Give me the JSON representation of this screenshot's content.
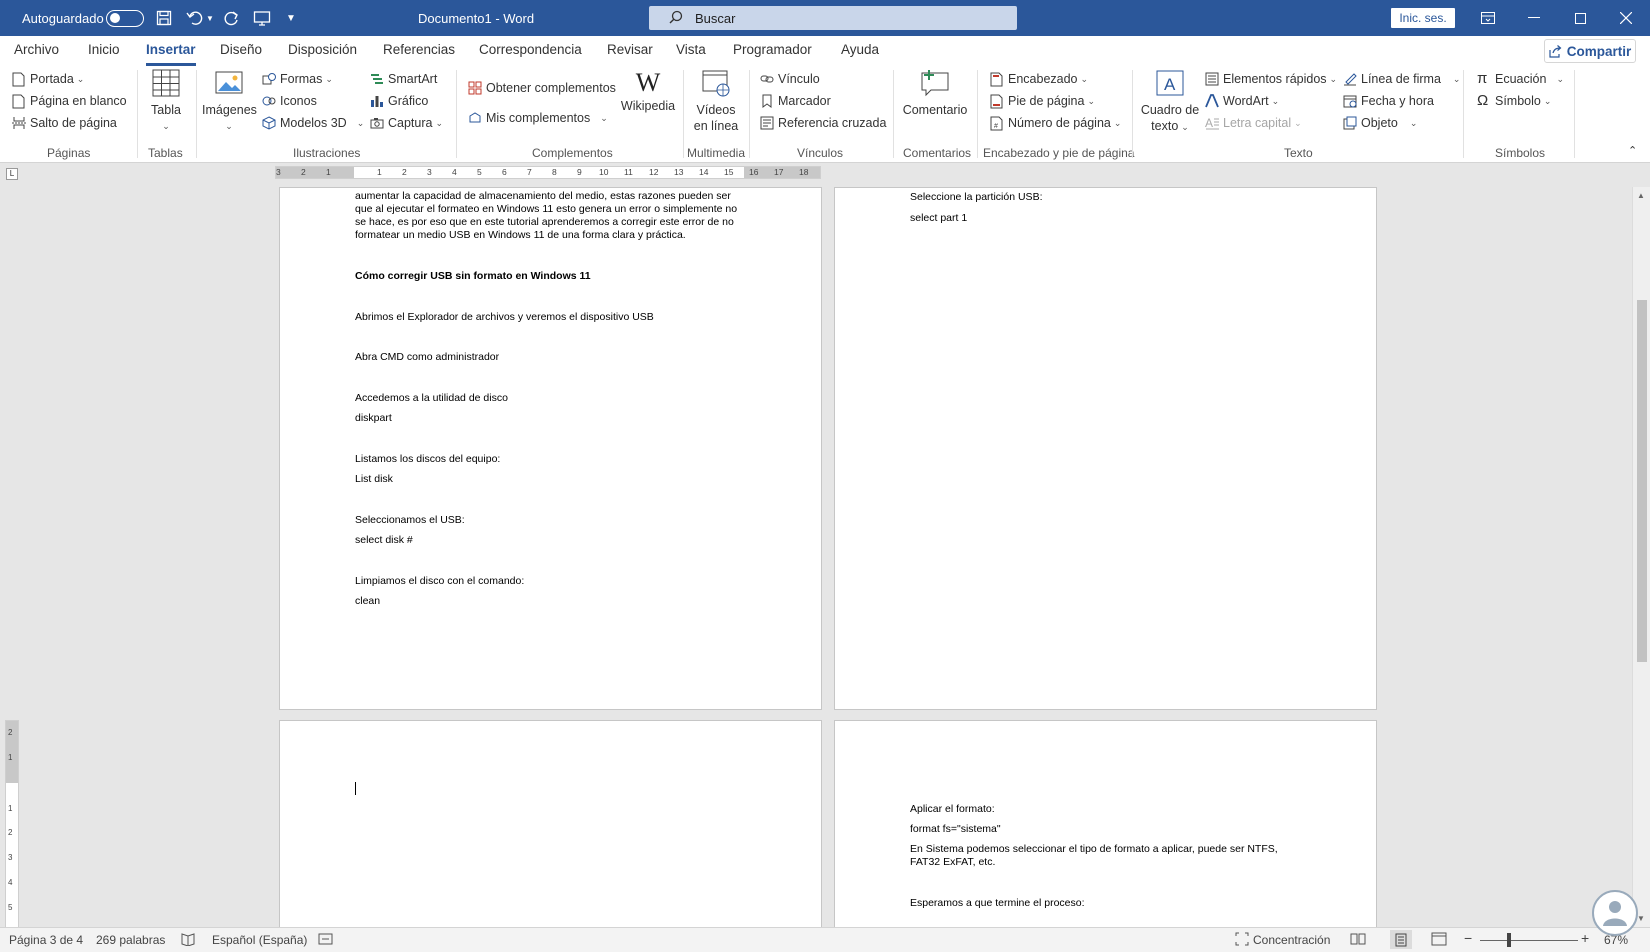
{
  "titlebar": {
    "autosave_label": "Autoguardado",
    "doc_title": "Documento1 - Word",
    "search_placeholder": "Buscar",
    "signin_label": "Inic. ses."
  },
  "tabs": [
    {
      "label": "Archivo"
    },
    {
      "label": "Inicio"
    },
    {
      "label": "Insertar"
    },
    {
      "label": "Diseño"
    },
    {
      "label": "Disposición"
    },
    {
      "label": "Referencias"
    },
    {
      "label": "Correspondencia"
    },
    {
      "label": "Revisar"
    },
    {
      "label": "Vista"
    },
    {
      "label": "Programador"
    },
    {
      "label": "Ayuda"
    }
  ],
  "share_label": "Compartir",
  "ribbon": {
    "paginas": {
      "portada": "Portada",
      "pagina_blanco": "Página en blanco",
      "salto": "Salto de página",
      "label": "Páginas"
    },
    "tablas": {
      "tabla": "Tabla",
      "label": "Tablas"
    },
    "ilustraciones": {
      "imagenes": "Imágenes",
      "formas": "Formas",
      "iconos": "Iconos",
      "modelos3d": "Modelos 3D",
      "smartart": "SmartArt",
      "grafico": "Gráfico",
      "captura": "Captura",
      "label": "Ilustraciones"
    },
    "complementos": {
      "obtener": "Obtener complementos",
      "mis": "Mis complementos",
      "wikipedia": "Wikipedia",
      "label": "Complementos"
    },
    "multimedia": {
      "videos_line1": "Vídeos",
      "videos_line2": "en línea",
      "label": "Multimedia"
    },
    "vinculos": {
      "vinculo": "Vínculo",
      "marcador": "Marcador",
      "referencia": "Referencia cruzada",
      "label": "Vínculos"
    },
    "comentarios": {
      "comentario": "Comentario",
      "label": "Comentarios"
    },
    "encabezado": {
      "encabezado": "Encabezado",
      "pie": "Pie de página",
      "numero": "Número de página",
      "label": "Encabezado y pie de página"
    },
    "texto": {
      "cuadro_line1": "Cuadro de",
      "cuadro_line2": "texto",
      "elementos": "Elementos rápidos",
      "wordart": "WordArt",
      "letra": "Letra capital",
      "linea_firma": "Línea de firma",
      "fecha": "Fecha y hora",
      "objeto": "Objeto",
      "label": "Texto"
    },
    "simbolos": {
      "ecuacion": "Ecuación",
      "simbolo": "Símbolo",
      "label": "Símbolos"
    }
  },
  "ruler_ticks": [
    "3",
    "2",
    "1",
    "1",
    "2",
    "3",
    "4",
    "5",
    "6",
    "7",
    "8",
    "9",
    "10",
    "11",
    "12",
    "13",
    "14",
    "15",
    "16",
    "17",
    "18"
  ],
  "vruler_ticks": [
    "2",
    "1",
    "1",
    "2",
    "3",
    "4",
    "5"
  ],
  "page1": {
    "intro": "aumentar la capacidad de almacenamiento del medio, estas razones pueden ser que al ejecutar el formateo en Windows 11 esto genera un error o simplemente no se hace, es por eso que en este tutorial aprenderemos a corregir este error de no formatear un medio USB en Windows 11 de una forma clara y práctica.",
    "heading": "Cómo corregir USB sin formato en Windows 11",
    "l1": "Abrimos el Explorador de archivos y veremos el dispositivo USB",
    "l2": "Abra CMD como administrador",
    "l3": "Accedemos a la utilidad de disco",
    "l4": "diskpart",
    "l5": "Listamos los discos del equipo:",
    "l6": "List disk",
    "l7": "Seleccionamos el USB:",
    "l8": "select disk #",
    "l9": "Limpiamos el disco con el comando:",
    "l10": "clean"
  },
  "page2": {
    "l1": "Seleccione la partición USB:",
    "l2": "select part 1"
  },
  "page4": {
    "l1": "Aplicar el formato:",
    "l2": "format fs=\"sistema\"",
    "l3": "En Sistema podemos seleccionar el tipo de formato a aplicar, puede ser NTFS, FAT32 ExFAT, etc.",
    "l4": "Esperamos a que termine el proceso:"
  },
  "statusbar": {
    "page": "Página 3 de 4",
    "words": "269 palabras",
    "language": "Español (España)",
    "focus": "Concentración",
    "zoom": "67%"
  },
  "colors": {
    "titlebar": "#2b579a",
    "accent": "#2b579a"
  }
}
